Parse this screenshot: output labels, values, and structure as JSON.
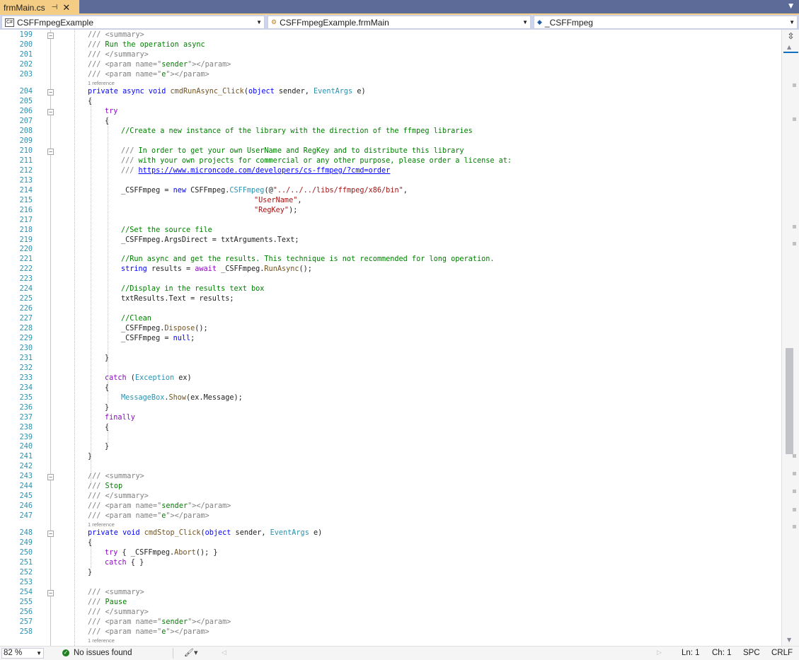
{
  "tab": {
    "filename": "frmMain.cs",
    "pin_glyph": "⊣",
    "close_glyph": "✕",
    "dropdown_glyph": "▼"
  },
  "navbar": {
    "project": "CSFFmpegExample",
    "class": "CSFFmpegExample.frmMain",
    "member": "_CSFFmpeg"
  },
  "code_lines": [
    {
      "n": "199",
      "fold": "⊟"
    },
    {
      "n": "200"
    },
    {
      "n": "201"
    },
    {
      "n": "202"
    },
    {
      "n": "203"
    },
    {
      "n": "204",
      "fold": "⊟"
    },
    {
      "n": "205"
    },
    {
      "n": "206",
      "fold": "⊟"
    },
    {
      "n": "207"
    },
    {
      "n": "208"
    },
    {
      "n": "209"
    },
    {
      "n": "210",
      "fold": "⊟"
    },
    {
      "n": "211"
    },
    {
      "n": "212"
    },
    {
      "n": "213"
    },
    {
      "n": "214"
    },
    {
      "n": "215"
    },
    {
      "n": "216"
    },
    {
      "n": "217"
    },
    {
      "n": "218"
    },
    {
      "n": "219"
    },
    {
      "n": "220"
    },
    {
      "n": "221"
    },
    {
      "n": "222"
    },
    {
      "n": "223"
    },
    {
      "n": "224"
    },
    {
      "n": "225"
    },
    {
      "n": "226"
    },
    {
      "n": "227"
    },
    {
      "n": "228"
    },
    {
      "n": "229"
    },
    {
      "n": "230"
    },
    {
      "n": "231"
    },
    {
      "n": "232"
    },
    {
      "n": "233"
    },
    {
      "n": "234"
    },
    {
      "n": "235"
    },
    {
      "n": "236"
    },
    {
      "n": "237"
    },
    {
      "n": "238"
    },
    {
      "n": "239"
    },
    {
      "n": "240"
    },
    {
      "n": "241"
    },
    {
      "n": "242"
    },
    {
      "n": "243",
      "fold": "⊟"
    },
    {
      "n": "244"
    },
    {
      "n": "245"
    },
    {
      "n": "246"
    },
    {
      "n": "247"
    },
    {
      "n": "248",
      "fold": "⊟"
    },
    {
      "n": "249"
    },
    {
      "n": "250"
    },
    {
      "n": "251"
    },
    {
      "n": "252"
    },
    {
      "n": "253"
    },
    {
      "n": "254",
      "fold": "⊟"
    },
    {
      "n": "255"
    },
    {
      "n": "256"
    },
    {
      "n": "257"
    },
    {
      "n": "258"
    }
  ],
  "code": {
    "l199": [
      [
        "xd",
        "/// <summary>"
      ]
    ],
    "l200": [
      [
        "xd",
        "/// "
      ],
      [
        "cm",
        "Run the operation async"
      ]
    ],
    "l201": [
      [
        "xd",
        "/// </summary>"
      ]
    ],
    "l202": [
      [
        "xd",
        "/// <param name=\""
      ],
      [
        "cm",
        "sender"
      ],
      [
        "xd",
        "\"></param>"
      ]
    ],
    "l203": [
      [
        "xd",
        "/// <param name=\""
      ],
      [
        "cm",
        "e"
      ],
      [
        "xd",
        "\"></param>"
      ]
    ],
    "l204": [
      [
        "kw",
        "private async void "
      ],
      [
        "mt",
        "cmdRunAsync_Click"
      ],
      [
        "",
        "("
      ],
      [
        "kw",
        "object"
      ],
      [
        "",
        " sender, "
      ],
      [
        "ty",
        "EventArgs"
      ],
      [
        "",
        " e)"
      ]
    ],
    "l205": [
      [
        "",
        "{"
      ]
    ],
    "l206": [
      [
        "ctl",
        "try"
      ]
    ],
    "l207": [
      [
        "",
        "{"
      ]
    ],
    "l208": [
      [
        "cm",
        "//Create a new instance of the library with the direction of the ffmpeg libraries"
      ]
    ],
    "l209": [],
    "l210": [
      [
        "xd",
        "/// "
      ],
      [
        "cm",
        "In order to get your own UserName and RegKey and to distribute this library"
      ]
    ],
    "l211": [
      [
        "xd",
        "/// "
      ],
      [
        "cm",
        "with your own projects for commercial or any other purpose, please order a license at:"
      ]
    ],
    "l212": [
      [
        "xd",
        "/// "
      ],
      [
        "lnk",
        "https://www.microncode.com/developers/cs-ffmpeg/?cmd=order"
      ]
    ],
    "l213": [],
    "l214": [
      [
        "",
        "_CSFFmpeg = "
      ],
      [
        "kw",
        "new"
      ],
      [
        "",
        " CSFFmpeg."
      ],
      [
        "ty",
        "CSFFmpeg"
      ],
      [
        "",
        "(@"
      ],
      [
        "st",
        "\"../../../libs/ffmpeg/x86/bin\""
      ],
      [
        "",
        ","
      ]
    ],
    "l215": [
      [
        "st",
        "\"UserName\""
      ],
      [
        "",
        ","
      ]
    ],
    "l216": [
      [
        "st",
        "\"RegKey\""
      ],
      [
        "",
        ");"
      ]
    ],
    "l217": [],
    "l218": [
      [
        "cm",
        "//Set the source file"
      ]
    ],
    "l219": [
      [
        "",
        "_CSFFmpeg.ArgsDirect = txtArguments.Text;"
      ]
    ],
    "l220": [],
    "l221": [
      [
        "cm",
        "//Run async and get the results. This technique is not recommended for long operation."
      ]
    ],
    "l222": [
      [
        "kw",
        "string"
      ],
      [
        "",
        " results = "
      ],
      [
        "ctl",
        "await"
      ],
      [
        "",
        " _CSFFmpeg."
      ],
      [
        "mt",
        "RunAsync"
      ],
      [
        "",
        "();"
      ]
    ],
    "l223": [],
    "l224": [
      [
        "cm",
        "//Display in the results text box"
      ]
    ],
    "l225": [
      [
        "",
        "txtResults.Text = results;"
      ]
    ],
    "l226": [],
    "l227": [
      [
        "cm",
        "//Clean"
      ]
    ],
    "l228": [
      [
        "",
        "_CSFFmpeg."
      ],
      [
        "mt",
        "Dispose"
      ],
      [
        "",
        "();"
      ]
    ],
    "l229": [
      [
        "",
        "_CSFFmpeg = "
      ],
      [
        "kw",
        "null"
      ],
      [
        "",
        ";"
      ]
    ],
    "l230": [],
    "l231": [
      [
        "",
        "}"
      ]
    ],
    "l232": [],
    "l233": [
      [
        "ctl",
        "catch"
      ],
      [
        "",
        " ("
      ],
      [
        "ty",
        "Exception"
      ],
      [
        "",
        " ex)"
      ]
    ],
    "l234": [
      [
        "",
        "{"
      ]
    ],
    "l235": [
      [
        "ty",
        "MessageBox"
      ],
      [
        "",
        "."
      ],
      [
        "mt",
        "Show"
      ],
      [
        "",
        "(ex.Message);"
      ]
    ],
    "l236": [
      [
        "",
        "}"
      ]
    ],
    "l237": [
      [
        "ctl",
        "finally"
      ]
    ],
    "l238": [
      [
        "",
        "{"
      ]
    ],
    "l239": [],
    "l240": [
      [
        "",
        "}"
      ]
    ],
    "l241": [
      [
        "",
        "}"
      ]
    ],
    "l242": [],
    "l243": [
      [
        "xd",
        "/// <summary>"
      ]
    ],
    "l244": [
      [
        "xd",
        "/// "
      ],
      [
        "cm",
        "Stop"
      ]
    ],
    "l245": [
      [
        "xd",
        "/// </summary>"
      ]
    ],
    "l246": [
      [
        "xd",
        "/// <param name=\""
      ],
      [
        "cm",
        "sender"
      ],
      [
        "xd",
        "\"></param>"
      ]
    ],
    "l247": [
      [
        "xd",
        "/// <param name=\""
      ],
      [
        "cm",
        "e"
      ],
      [
        "xd",
        "\"></param>"
      ]
    ],
    "l248": [
      [
        "kw",
        "private void "
      ],
      [
        "mt",
        "cmdStop_Click"
      ],
      [
        "",
        "("
      ],
      [
        "kw",
        "object"
      ],
      [
        "",
        " sender, "
      ],
      [
        "ty",
        "EventArgs"
      ],
      [
        "",
        " e)"
      ]
    ],
    "l249": [
      [
        "",
        "{"
      ]
    ],
    "l250": [
      [
        "ctl",
        "try"
      ],
      [
        "",
        " { _CSFFmpeg."
      ],
      [
        "mt",
        "Abort"
      ],
      [
        "",
        "(); }"
      ]
    ],
    "l251": [
      [
        "ctl",
        "catch"
      ],
      [
        "",
        " { }"
      ]
    ],
    "l252": [
      [
        "",
        "}"
      ]
    ],
    "l253": [],
    "l254": [
      [
        "xd",
        "/// <summary>"
      ]
    ],
    "l255": [
      [
        "xd",
        "/// "
      ],
      [
        "cm",
        "Pause"
      ]
    ],
    "l256": [
      [
        "xd",
        "/// </summary>"
      ]
    ],
    "l257": [
      [
        "xd",
        "/// <param name=\""
      ],
      [
        "cm",
        "sender"
      ],
      [
        "xd",
        "\"></param>"
      ]
    ],
    "l258": [
      [
        "xd",
        "/// <param name=\""
      ],
      [
        "cm",
        "e"
      ],
      [
        "xd",
        "\"></param>"
      ]
    ]
  },
  "codelens": {
    "ref_label": "1 reference"
  },
  "statusbar": {
    "zoom": "82 %",
    "issues": "No issues found",
    "line": "Ln: 1",
    "col": "Ch: 1",
    "whitespace": "SPC",
    "line_ending": "CRLF"
  },
  "colors": {
    "tab_active": "#f5cc84",
    "tabstrip_bg": "#5d6b99",
    "navbar_bg": "#ccd5f0",
    "line_number": "#2b91af"
  }
}
